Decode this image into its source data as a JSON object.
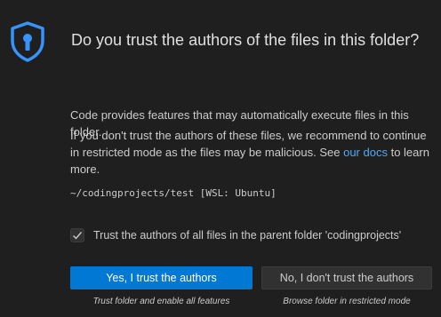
{
  "dialog": {
    "title": "Do you trust the authors of the files in this folder?",
    "icon": "shield-lock-icon",
    "accent_color": "#0078d4",
    "paragraph1": "Code provides features that may automatically execute files in this folder.",
    "paragraph2_prefix": "If you don't trust the authors of these files, we recommend to continue in restricted mode as the files may be malicious. See ",
    "paragraph2_link": "our docs",
    "paragraph2_suffix": " to learn more.",
    "path": "~/codingprojects/test [WSL: Ubuntu]",
    "checkbox": {
      "label": "Trust the authors of all files in the parent folder 'codingprojects'",
      "checked": true
    },
    "buttons": {
      "yes_label": "Yes, I trust the authors",
      "yes_caption": "Trust folder and enable all features",
      "no_label": "No, I don't trust the authors",
      "no_caption": "Browse folder in restricted mode"
    }
  }
}
